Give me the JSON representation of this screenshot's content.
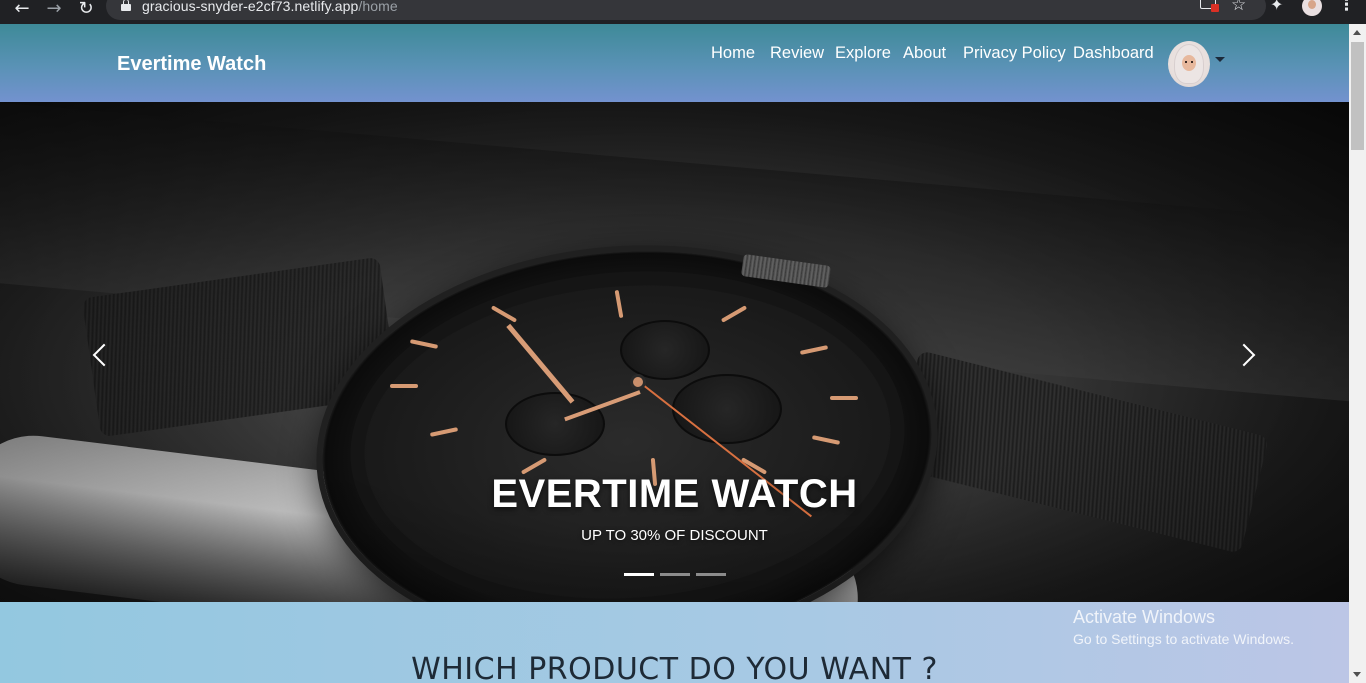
{
  "browser": {
    "url_host": "gracious-snyder-e2cf73.netlify.app",
    "url_path": "/home",
    "icons": [
      "back-arrow-icon",
      "forward-arrow-icon",
      "reload-icon",
      "lock-icon",
      "cast-icon",
      "star-icon",
      "extensions-icon",
      "profile-avatar-icon",
      "menu-kebab-icon"
    ]
  },
  "navbar": {
    "brand": "Evertime Watch",
    "links": [
      "Home",
      "Review",
      "Explore",
      "About",
      "Privacy Policy",
      "Dashboard"
    ]
  },
  "hero": {
    "title": "EVERTIME WATCH",
    "subtitle": "UP TO 30% OF DISCOUNT",
    "slide_count": 3,
    "active_slide": 1
  },
  "section": {
    "title": "WHICH PRODUCT DO YOU WANT ?"
  },
  "watermark": {
    "line1": "Activate Windows",
    "line2": "Go to Settings to activate Windows."
  },
  "colors": {
    "navbar_top": "#3e8a98",
    "navbar_bottom": "#7392cf",
    "section_bg": "#a8c9e4",
    "accent_gold": "#d69a73"
  }
}
